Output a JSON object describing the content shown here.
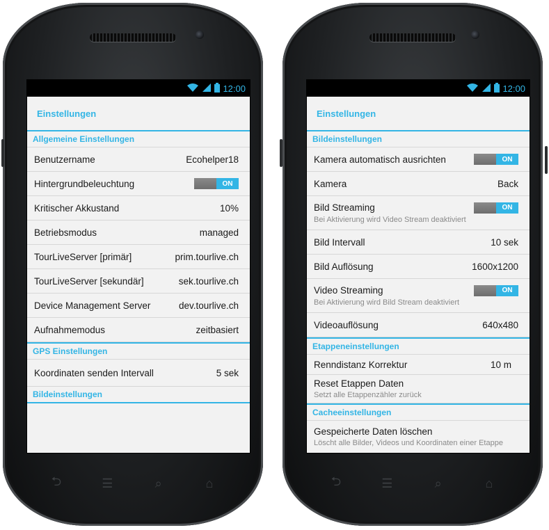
{
  "status": {
    "time": "12:00",
    "wifi_icon": "wifi-icon",
    "signal_icon": "signal-icon",
    "battery_icon": "battery-icon",
    "accent": "#33b5e5"
  },
  "left": {
    "title": "Einstellungen",
    "sections": {
      "allgemein": "Allgemeine Einstellungen",
      "gps": "GPS Einstellungen",
      "bild": "Bildeinstellungen"
    },
    "rows": {
      "benutzername": {
        "label": "Benutzername",
        "value": "Ecohelper18"
      },
      "hintergrund": {
        "label": "Hintergrundbeleuchtung",
        "toggle": "ON"
      },
      "akku": {
        "label": "Kritischer Akkustand",
        "value": "10%"
      },
      "betrieb": {
        "label": "Betriebsmodus",
        "value": "managed"
      },
      "primaer": {
        "label": "TourLiveServer [primär]",
        "value": "prim.tourlive.ch"
      },
      "sekundaer": {
        "label": "TourLiveServer [sekundär]",
        "value": "sek.tourlive.ch"
      },
      "device": {
        "label": "Device Management Server",
        "value": "dev.tourlive.ch"
      },
      "aufnahme": {
        "label": "Aufnahmemodus",
        "value": "zeitbasiert"
      },
      "koordinaten": {
        "label": "Koordinaten senden Intervall",
        "value": "5 sek"
      }
    }
  },
  "right": {
    "title": "Einstellungen",
    "sections": {
      "bild": "Bildeinstellungen",
      "etappe": "Etappeneinstellungen",
      "cache": "Cacheeinstellungen"
    },
    "rows": {
      "kamera_auto": {
        "label": "Kamera automatisch ausrichten",
        "toggle": "ON"
      },
      "kamera": {
        "label": "Kamera",
        "value": "Back"
      },
      "bild_streaming": {
        "label": "Bild Streaming",
        "toggle": "ON",
        "sub": "Bei Aktivierung wird Video Stream deaktiviert"
      },
      "bild_intervall": {
        "label": "Bild Intervall",
        "value": "10 sek"
      },
      "bild_aufloesung": {
        "label": "Bild Auflösung",
        "value": "1600x1200"
      },
      "video_streaming": {
        "label": "Video Streaming",
        "toggle": "ON",
        "sub": "Bei Aktivierung wird Bild Stream deaktiviert"
      },
      "video_aufloesung": {
        "label": "Videoauflösung",
        "value": "640x480"
      },
      "renndistanz": {
        "label": "Renndistanz Korrektur",
        "value": "10 m"
      },
      "reset": {
        "label": "Reset Etappen Daten",
        "sub": "Setzt alle Etappenzähler zurück"
      },
      "gespeichert": {
        "label": "Gespeicherte Daten löschen",
        "sub": "Löscht alle Bilder, Videos und Koordinaten einer Etappe"
      }
    }
  },
  "nav": {
    "back_icon": "back-icon",
    "menu_icon": "menu-icon",
    "search_icon": "search-icon",
    "home_icon": "home-icon"
  }
}
